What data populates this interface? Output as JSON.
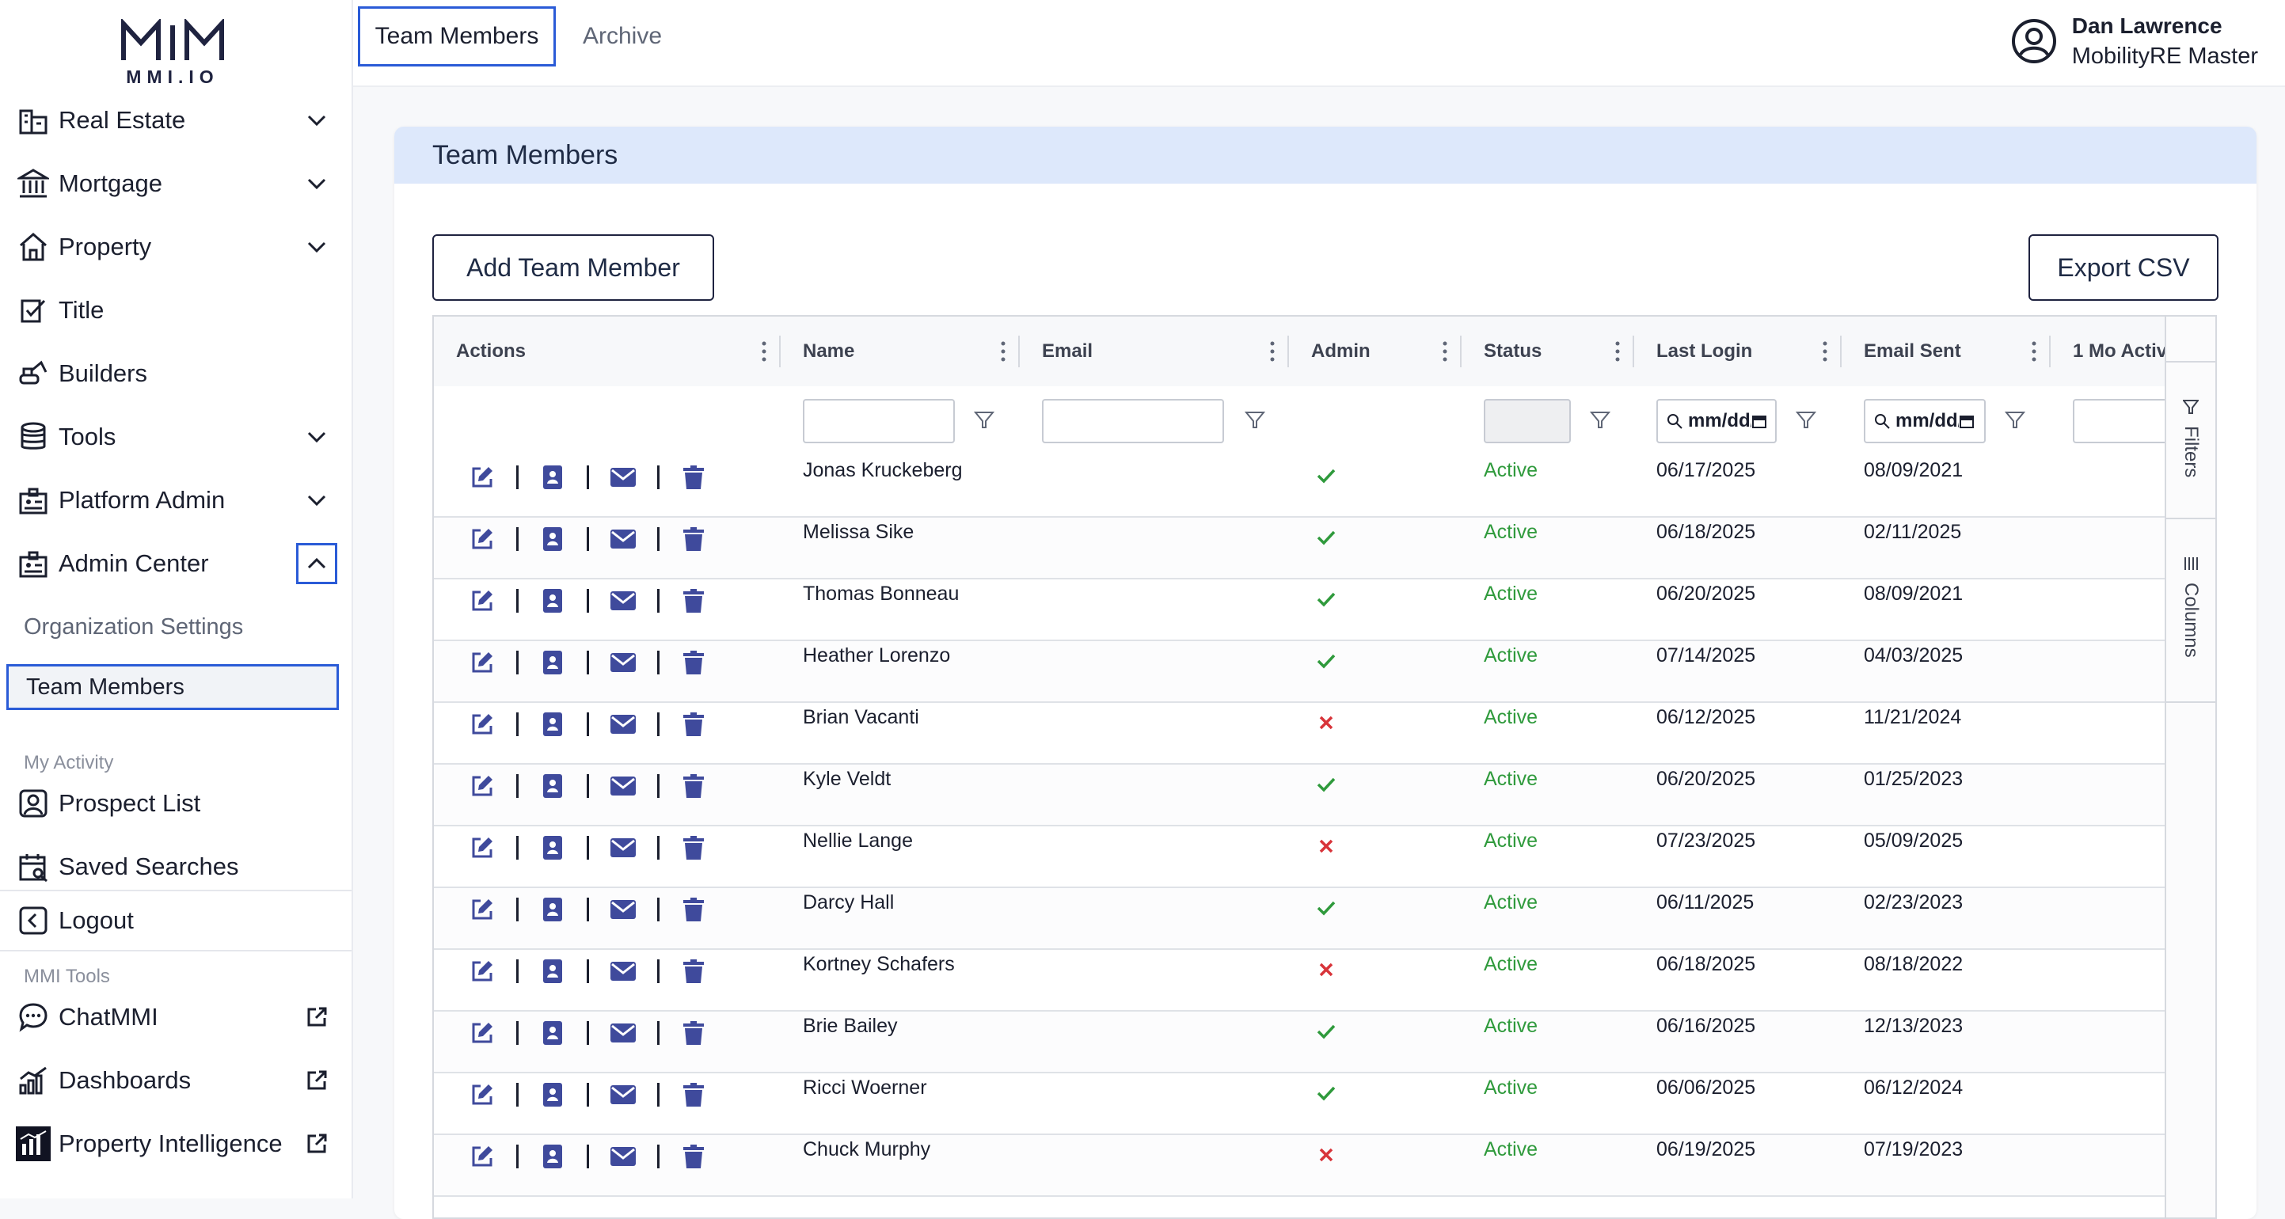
{
  "brand": {
    "logo_text": "MMI.IO"
  },
  "sidebar": {
    "items": [
      {
        "label": "Real Estate",
        "icon": "building-icon",
        "expandable": true
      },
      {
        "label": "Mortgage",
        "icon": "bank-icon",
        "expandable": true
      },
      {
        "label": "Property",
        "icon": "house-icon",
        "expandable": true
      },
      {
        "label": "Title",
        "icon": "title-icon",
        "expandable": false
      },
      {
        "label": "Builders",
        "icon": "excavator-icon",
        "expandable": false
      },
      {
        "label": "Tools",
        "icon": "database-icon",
        "expandable": true
      },
      {
        "label": "Platform Admin",
        "icon": "admin-badge-icon",
        "expandable": true
      },
      {
        "label": "Admin Center",
        "icon": "admin-badge-icon",
        "expandable": true,
        "expanded": true
      }
    ],
    "admin_center_children": {
      "organization_settings": "Organization Settings",
      "team_members": "Team Members"
    },
    "my_activity": {
      "section_label": "My Activity",
      "prospect_list": "Prospect List",
      "saved_searches": "Saved Searches"
    },
    "logout": "Logout",
    "mmi_tools": {
      "section_label": "MMI Tools",
      "items": [
        {
          "label": "ChatMMI",
          "icon": "chat-icon"
        },
        {
          "label": "Dashboards",
          "icon": "chart-icon"
        },
        {
          "label": "Property Intelligence",
          "icon": "property-intelligence-icon"
        }
      ]
    }
  },
  "topbar": {
    "tabs": [
      {
        "label": "Team Members",
        "active": true
      },
      {
        "label": "Archive",
        "active": false
      }
    ],
    "user": {
      "name": "Dan Lawrence",
      "role": "MobilityRE Master"
    }
  },
  "panel": {
    "title": "Team Members",
    "add_button": "Add Team Member",
    "export_button": "Export CSV"
  },
  "grid": {
    "columns": [
      "Actions",
      "Name",
      "Email",
      "Admin",
      "Status",
      "Last Login",
      "Email Sent",
      "1 Mo Activ"
    ],
    "date_placeholder": "mm/dd/yyyy",
    "side_tabs": {
      "filters": "Filters",
      "columns": "Columns"
    },
    "rows": [
      {
        "name": "Jonas Kruckeberg",
        "admin": true,
        "status": "Active",
        "last_login": "06/17/2025",
        "email_sent": "08/09/2021"
      },
      {
        "name": "Melissa Sike",
        "admin": true,
        "status": "Active",
        "last_login": "06/18/2025",
        "email_sent": "02/11/2025"
      },
      {
        "name": "Thomas Bonneau",
        "admin": true,
        "status": "Active",
        "last_login": "06/20/2025",
        "email_sent": "08/09/2021"
      },
      {
        "name": "Heather Lorenzo",
        "admin": true,
        "status": "Active",
        "last_login": "07/14/2025",
        "email_sent": "04/03/2025"
      },
      {
        "name": "Brian Vacanti",
        "admin": false,
        "status": "Active",
        "last_login": "06/12/2025",
        "email_sent": "11/21/2024"
      },
      {
        "name": "Kyle Veldt",
        "admin": true,
        "status": "Active",
        "last_login": "06/20/2025",
        "email_sent": "01/25/2023"
      },
      {
        "name": "Nellie Lange",
        "admin": false,
        "status": "Active",
        "last_login": "07/23/2025",
        "email_sent": "05/09/2025"
      },
      {
        "name": "Darcy Hall",
        "admin": true,
        "status": "Active",
        "last_login": "06/11/2025",
        "email_sent": "02/23/2023"
      },
      {
        "name": "Kortney Schafers",
        "admin": false,
        "status": "Active",
        "last_login": "06/18/2025",
        "email_sent": "08/18/2022"
      },
      {
        "name": "Brie Bailey",
        "admin": true,
        "status": "Active",
        "last_login": "06/16/2025",
        "email_sent": "12/13/2023"
      },
      {
        "name": "Ricci Woerner",
        "admin": true,
        "status": "Active",
        "last_login": "06/06/2025",
        "email_sent": "06/12/2024"
      },
      {
        "name": "Chuck Murphy",
        "admin": false,
        "status": "Active",
        "last_login": "06/19/2025",
        "email_sent": "07/19/2023"
      }
    ]
  },
  "colors": {
    "accent": "#2a5bd7",
    "icon": "#3f4a9c",
    "success": "#2f9a3c",
    "danger": "#d8343a",
    "header_bg": "#dde8fb"
  }
}
